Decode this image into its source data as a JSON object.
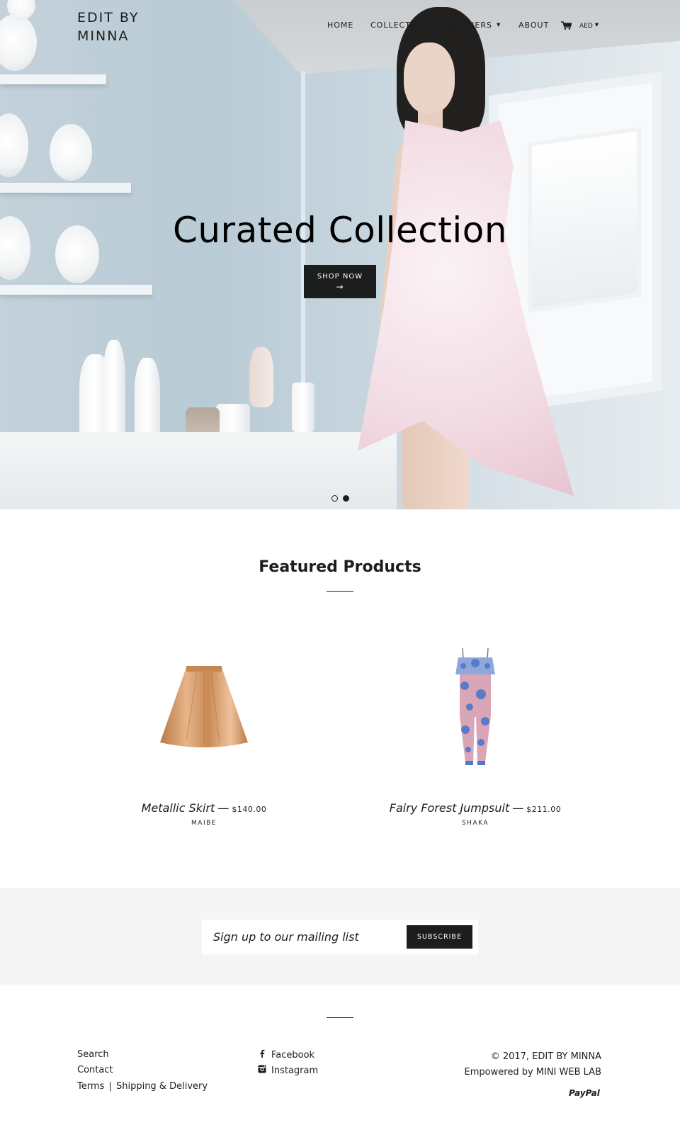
{
  "header": {
    "logo": "EDIT BY MINNA",
    "nav": [
      {
        "label": "HOME"
      },
      {
        "label": "COLLECTION"
      },
      {
        "label": "DESIGNERS"
      },
      {
        "label": "ABOUT"
      }
    ],
    "cart_icon": "cart-icon",
    "currency": "AED"
  },
  "hero": {
    "title": "Curated Collection",
    "button_label": "SHOP NOW",
    "button_arrow": "→",
    "slides": 2,
    "active_slide": 2
  },
  "featured": {
    "title": "Featured Products",
    "products": [
      {
        "name": "Metallic Skirt",
        "dash": "—",
        "price": "$140.00",
        "vendor": "MAIBE"
      },
      {
        "name": "Fairy Forest Jumpsuit",
        "dash": "—",
        "price": "$211.00",
        "vendor": "SHAKA"
      }
    ]
  },
  "newsletter": {
    "placeholder": "Sign up to our mailing list",
    "button_label": "SUBSCRIBE"
  },
  "footer": {
    "links": {
      "search": "Search",
      "contact": "Contact",
      "terms": "Terms",
      "separator": "|",
      "shipping": "Shipping & Delivery"
    },
    "social": [
      {
        "label": "Facebook",
        "icon": "facebook-icon"
      },
      {
        "label": "Instagram",
        "icon": "instagram-icon"
      }
    ],
    "copyright": "© 2017, EDIT BY MINNA",
    "powered_by": "Empowered by MINI WEB LAB",
    "payment": "PayPal"
  },
  "colors": {
    "text": "#1c1d1d",
    "button_bg": "#1c1d1d",
    "newsletter_bg": "#f5f5f5"
  }
}
